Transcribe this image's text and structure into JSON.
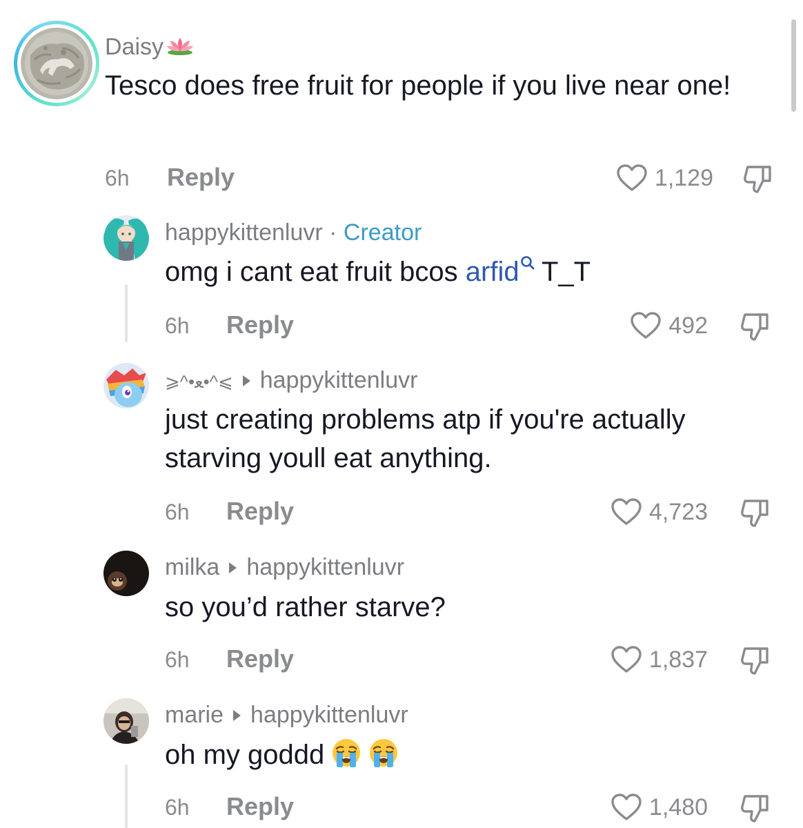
{
  "comments": [
    {
      "username": "Daisy",
      "username_suffix_icon": "lotus-emoji",
      "text": "Tesco does free fruit for people if you live near one!",
      "time": "6h",
      "reply_label": "Reply",
      "likes": "1,129"
    },
    {
      "username": "happykittenluvr",
      "separator": "·",
      "badge": "Creator",
      "text_before_link": "omg i cant eat fruit bcos ",
      "link_text": "arfid",
      "text_after_link": " T_T",
      "time": "6h",
      "reply_label": "Reply",
      "likes": "492"
    },
    {
      "username": "⩾^•ﻌ•^⩽",
      "reply_to": "happykittenluvr",
      "text": "just creating problems atp if you're actually starving youll eat anything.",
      "time": "6h",
      "reply_label": "Reply",
      "likes": "4,723"
    },
    {
      "username": "milka",
      "reply_to": "happykittenluvr",
      "text": "so you’d rather starve?",
      "time": "6h",
      "reply_label": "Reply",
      "likes": "1,837"
    },
    {
      "username": "marie",
      "reply_to": "happykittenluvr",
      "text": "oh my goddd",
      "text_emojis": [
        "loudly-crying-face-emoji",
        "loudly-crying-face-emoji"
      ],
      "time": "6h",
      "reply_label": "Reply",
      "likes": "1,480"
    }
  ],
  "colors": {
    "username": "#7c7d82",
    "creator_badge": "#3b9bc9",
    "link": "#2f58b0",
    "meta": "#8a8b8f",
    "text": "#161823"
  }
}
